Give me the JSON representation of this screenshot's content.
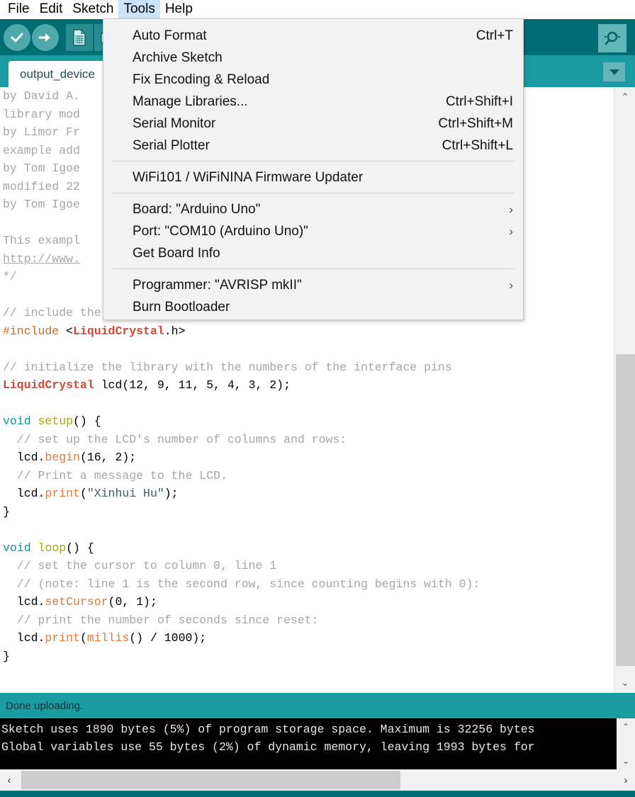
{
  "menubar": {
    "items": [
      {
        "label": "File",
        "active": false
      },
      {
        "label": "Edit",
        "active": false
      },
      {
        "label": "Sketch",
        "active": false
      },
      {
        "label": "Tools",
        "active": true
      },
      {
        "label": "Help",
        "active": false
      }
    ]
  },
  "toolbar": {
    "buttons": [
      {
        "name": "verify-button",
        "icon": "check-icon",
        "shape": "circle"
      },
      {
        "name": "upload-button",
        "icon": "arrow-right-icon",
        "shape": "circle"
      },
      {
        "name": "new-sketch-button",
        "icon": "new-file-icon",
        "shape": "square"
      },
      {
        "name": "open-sketch-button",
        "icon": "open-folder-icon",
        "shape": "square"
      }
    ],
    "serial_monitor": {
      "name": "serial-monitor-button",
      "icon": "magnifier-icon"
    }
  },
  "tabbar": {
    "tab_label": "output_device",
    "dropdown_icon": "chevron-down-icon"
  },
  "tools_menu": {
    "groups": [
      {
        "items": [
          {
            "label": "Auto Format",
            "shortcut": "Ctrl+T",
            "submenu": false
          },
          {
            "label": "Archive Sketch",
            "shortcut": "",
            "submenu": false
          },
          {
            "label": "Fix Encoding & Reload",
            "shortcut": "",
            "submenu": false
          },
          {
            "label": "Manage Libraries...",
            "shortcut": "Ctrl+Shift+I",
            "submenu": false
          },
          {
            "label": "Serial Monitor",
            "shortcut": "Ctrl+Shift+M",
            "submenu": false
          },
          {
            "label": "Serial Plotter",
            "shortcut": "Ctrl+Shift+L",
            "submenu": false
          }
        ]
      },
      {
        "items": [
          {
            "label": "WiFi101 / WiFiNINA Firmware Updater",
            "shortcut": "",
            "submenu": false
          }
        ]
      },
      {
        "items": [
          {
            "label": "Board: \"Arduino Uno\"",
            "shortcut": "",
            "submenu": true
          },
          {
            "label": "Port: \"COM10 (Arduino Uno)\"",
            "shortcut": "",
            "submenu": true
          },
          {
            "label": "Get Board Info",
            "shortcut": "",
            "submenu": false
          }
        ]
      },
      {
        "items": [
          {
            "label": "Programmer: \"AVRISP mkII\"",
            "shortcut": "",
            "submenu": true
          },
          {
            "label": "Burn Bootloader",
            "shortcut": "",
            "submenu": false
          }
        ]
      }
    ]
  },
  "editor": {
    "header_comment_lines": [
      "by David A. ",
      "library mod",
      "by Limor Fr",
      "example add",
      "by Tom Igoe",
      "modified 22",
      "by Tom Igoe",
      "",
      "This exampl"
    ],
    "header_link": "http://www.",
    "header_close": "*/",
    "code_lines": [
      {
        "id": "l1",
        "segments": [
          {
            "t": "// include the library code:",
            "c": "cmt"
          }
        ]
      },
      {
        "id": "l2",
        "segments": [
          {
            "t": "#include ",
            "c": "pre"
          },
          {
            "t": "<",
            "c": "pun"
          },
          {
            "t": "LiquidCrystal",
            "c": "lib"
          },
          {
            "t": ".h>",
            "c": "pun"
          }
        ]
      },
      {
        "id": "l3",
        "segments": [
          {
            "t": "",
            "c": "pun"
          }
        ]
      },
      {
        "id": "l4",
        "segments": [
          {
            "t": "// initialize the library with the numbers of the interface pins",
            "c": "cmt"
          }
        ]
      },
      {
        "id": "l5",
        "segments": [
          {
            "t": "LiquidCrystal",
            "c": "lib"
          },
          {
            "t": " lcd(12, 9, 11, 5, 4, 3, 2);",
            "c": "pun"
          }
        ]
      },
      {
        "id": "l6",
        "segments": [
          {
            "t": "",
            "c": "pun"
          }
        ]
      },
      {
        "id": "l7",
        "segments": [
          {
            "t": "void",
            "c": "kw"
          },
          {
            "t": " ",
            "c": "pun"
          },
          {
            "t": "setup",
            "c": "fn"
          },
          {
            "t": "() {",
            "c": "pun"
          }
        ]
      },
      {
        "id": "l8",
        "segments": [
          {
            "t": "  // set up the LCD's number of columns and rows:",
            "c": "cmt"
          }
        ]
      },
      {
        "id": "l9",
        "segments": [
          {
            "t": "  lcd.",
            "c": "pun"
          },
          {
            "t": "begin",
            "c": "mth"
          },
          {
            "t": "(16, 2);",
            "c": "pun"
          }
        ]
      },
      {
        "id": "l10",
        "segments": [
          {
            "t": "  // Print a message to the LCD.",
            "c": "cmt"
          }
        ]
      },
      {
        "id": "l11",
        "segments": [
          {
            "t": "  lcd.",
            "c": "pun"
          },
          {
            "t": "print",
            "c": "mth"
          },
          {
            "t": "(",
            "c": "pun"
          },
          {
            "t": "\"Xinhui Hu\"",
            "c": "str"
          },
          {
            "t": ");",
            "c": "pun"
          }
        ]
      },
      {
        "id": "l12",
        "segments": [
          {
            "t": "}",
            "c": "pun"
          }
        ]
      },
      {
        "id": "l13",
        "segments": [
          {
            "t": "",
            "c": "pun"
          }
        ]
      },
      {
        "id": "l14",
        "segments": [
          {
            "t": "void",
            "c": "kw"
          },
          {
            "t": " ",
            "c": "pun"
          },
          {
            "t": "loop",
            "c": "fn"
          },
          {
            "t": "() {",
            "c": "pun"
          }
        ]
      },
      {
        "id": "l15",
        "segments": [
          {
            "t": "  // set the cursor to column 0, line 1",
            "c": "cmt"
          }
        ]
      },
      {
        "id": "l16",
        "segments": [
          {
            "t": "  // (note: line 1 is the second row, since counting begins with 0):",
            "c": "cmt"
          }
        ]
      },
      {
        "id": "l17",
        "segments": [
          {
            "t": "  lcd.",
            "c": "pun"
          },
          {
            "t": "setCursor",
            "c": "mth"
          },
          {
            "t": "(0, 1);",
            "c": "pun"
          }
        ]
      },
      {
        "id": "l18",
        "segments": [
          {
            "t": "  // print the number of seconds since reset:",
            "c": "cmt"
          }
        ]
      },
      {
        "id": "l19",
        "segments": [
          {
            "t": "  lcd.",
            "c": "pun"
          },
          {
            "t": "print",
            "c": "mth"
          },
          {
            "t": "(",
            "c": "pun"
          },
          {
            "t": "millis",
            "c": "mth"
          },
          {
            "t": "() / 1000);",
            "c": "pun"
          }
        ]
      },
      {
        "id": "l20",
        "segments": [
          {
            "t": "}",
            "c": "pun"
          }
        ]
      }
    ]
  },
  "status": {
    "message": "Done uploading."
  },
  "console": {
    "lines": [
      "Sketch uses 1890 bytes (5%) of program storage space. Maximum is 32256 bytes",
      "Global variables use 55 bytes (2%) of dynamic memory, leaving 1993 bytes for"
    ]
  },
  "scrollbars": {
    "up_arrow": "⌃",
    "down_arrow": "⌄",
    "left_arrow": "‹",
    "right_arrow": "›"
  },
  "colors": {
    "toolbar": "#006d75",
    "tabbar": "#1a9ba1",
    "status": "#1a9ba1",
    "console_bg": "#000000",
    "menu_bg": "#f2f2f2",
    "menu_highlight": "#cce4f7",
    "keyword": "#00979c",
    "function": "#a8a800",
    "method": "#e07b39",
    "comment": "#a6a6a6",
    "library": "#d14836"
  }
}
